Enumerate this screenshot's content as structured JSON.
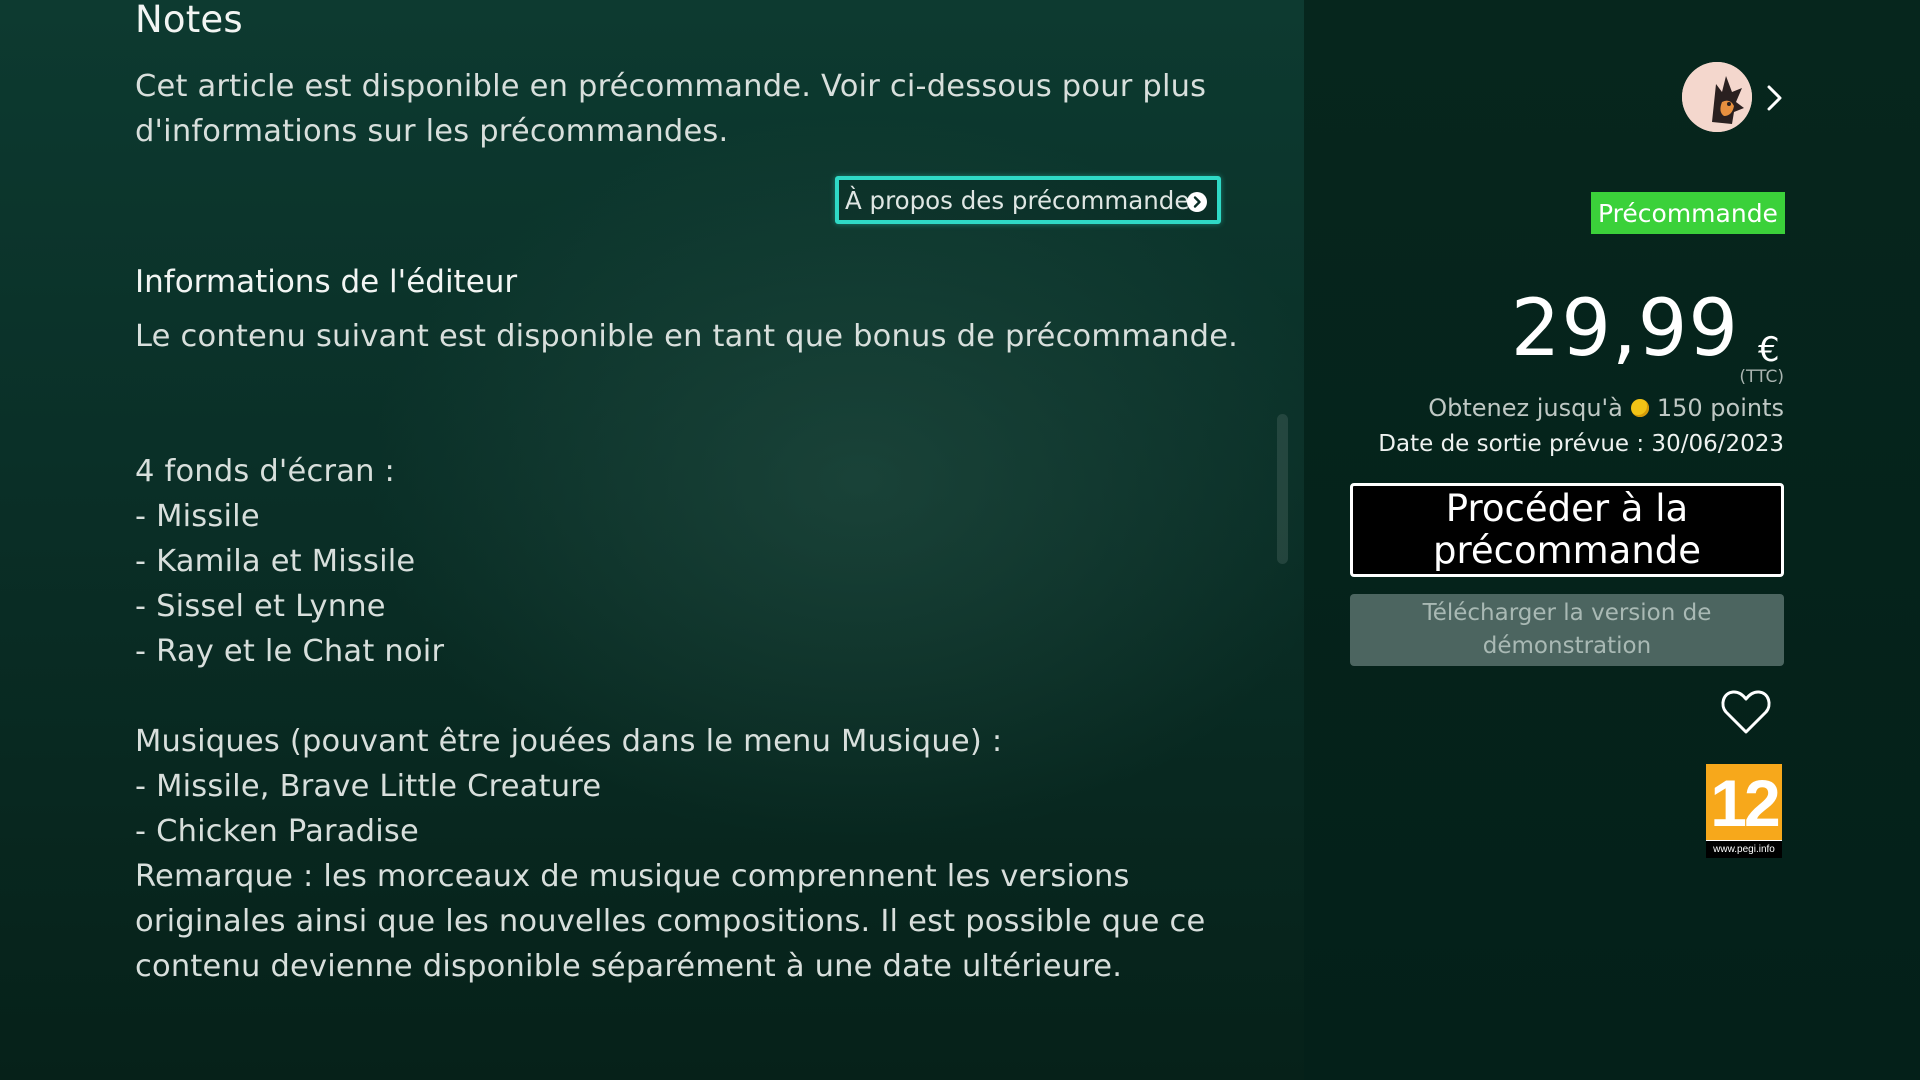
{
  "notes": {
    "heading": "Notes",
    "lines": [
      "Cet article est disponible en précommande. Voir ci-dessous pour plus",
      "d'informations sur les précommandes."
    ],
    "about_button_label": "À propos des précommandes"
  },
  "publisher": {
    "heading": "Informations de l'éditeur",
    "intro": "Le contenu suivant est disponible en tant que bonus de précommande.",
    "wallpapers": [
      "4 fonds d'écran :",
      "- Missile",
      "- Kamila et Missile",
      "- Sissel et Lynne",
      "- Ray et le Chat noir"
    ],
    "music": [
      "Musiques (pouvant être jouées dans le menu Musique) :",
      "- Missile, Brave Little Creature",
      "- Chicken Paradise",
      "Remarque : les morceaux de musique comprennent les versions",
      "originales ainsi que les nouvelles compositions. Il est possible que ce",
      "contenu devienne disponible séparément à une date ultérieure."
    ]
  },
  "purchase": {
    "badge": "Précommande",
    "price": "29,99",
    "currency": "€",
    "tax_note": "(TTC)",
    "points_prefix": "Obtenez jusqu'à",
    "points_value": "150 points",
    "release_date": "Date de sortie prévue : 30/06/2023",
    "proceed_label": "Procéder à la précommande",
    "demo_label": "Télécharger la version de démonstration"
  },
  "rating": {
    "age": "12",
    "url": "www.pegi.info"
  },
  "colors": {
    "focus_outline": "#2fd9c6",
    "badge_green": "#3bd13a",
    "pegi_orange": "#f7a81b"
  }
}
